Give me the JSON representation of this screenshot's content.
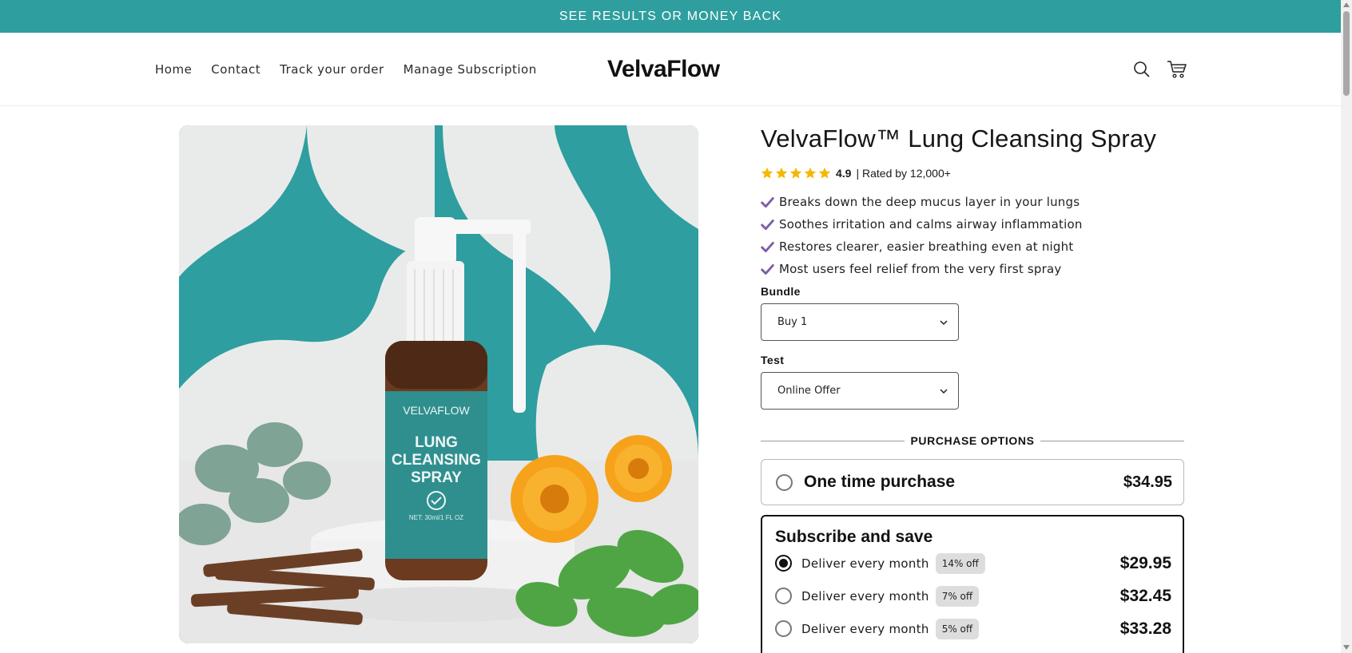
{
  "announcement": {
    "text": "SEE RESULTS OR MONEY BACK"
  },
  "header": {
    "nav": [
      {
        "label": "Home"
      },
      {
        "label": "Contact"
      },
      {
        "label": "Track your order"
      },
      {
        "label": "Manage Subscription"
      }
    ],
    "logo": "VelvaFlow",
    "icons": [
      "search-icon",
      "cart-icon"
    ]
  },
  "product": {
    "image": {
      "brand_text": "VELVAFLOW",
      "label_line1": "LUNG",
      "label_line2": "CLEANSING",
      "label_line3": "SPRAY",
      "net_text": "NET: 30ml/1 FL OZ"
    },
    "title": "VelvaFlow™ Lung Cleansing Spray",
    "rating": {
      "score": "4.9",
      "text": "| Rated by 12,000+",
      "stars": 5
    },
    "bullets": [
      "Breaks down the deep mucus layer in your lungs",
      "Soothes irritation and calms airway inflammation",
      "Restores clearer, easier breathing even at night",
      "Most users feel relief from the very first spray"
    ],
    "bundle": {
      "label": "Bundle",
      "value": "Buy 1"
    },
    "test": {
      "label": "Test",
      "value": "Online Offer"
    },
    "purchase_options_label": "PURCHASE OPTIONS",
    "one_time": {
      "label": "One time purchase",
      "price": "$34.95",
      "selected": false
    },
    "subscribe": {
      "title": "Subscribe and save",
      "options": [
        {
          "label": "Deliver every month",
          "badge": "14% off",
          "price": "$29.95",
          "selected": true
        },
        {
          "label": "Deliver every month",
          "badge": "7% off",
          "price": "$32.45",
          "selected": false
        },
        {
          "label": "Deliver every month",
          "badge": "5% off",
          "price": "$33.28",
          "selected": false
        }
      ]
    }
  },
  "colors": {
    "accent_teal": "#2e9e9e",
    "check_purple": "#7b5ea7",
    "star_gold": "#f5b800"
  }
}
